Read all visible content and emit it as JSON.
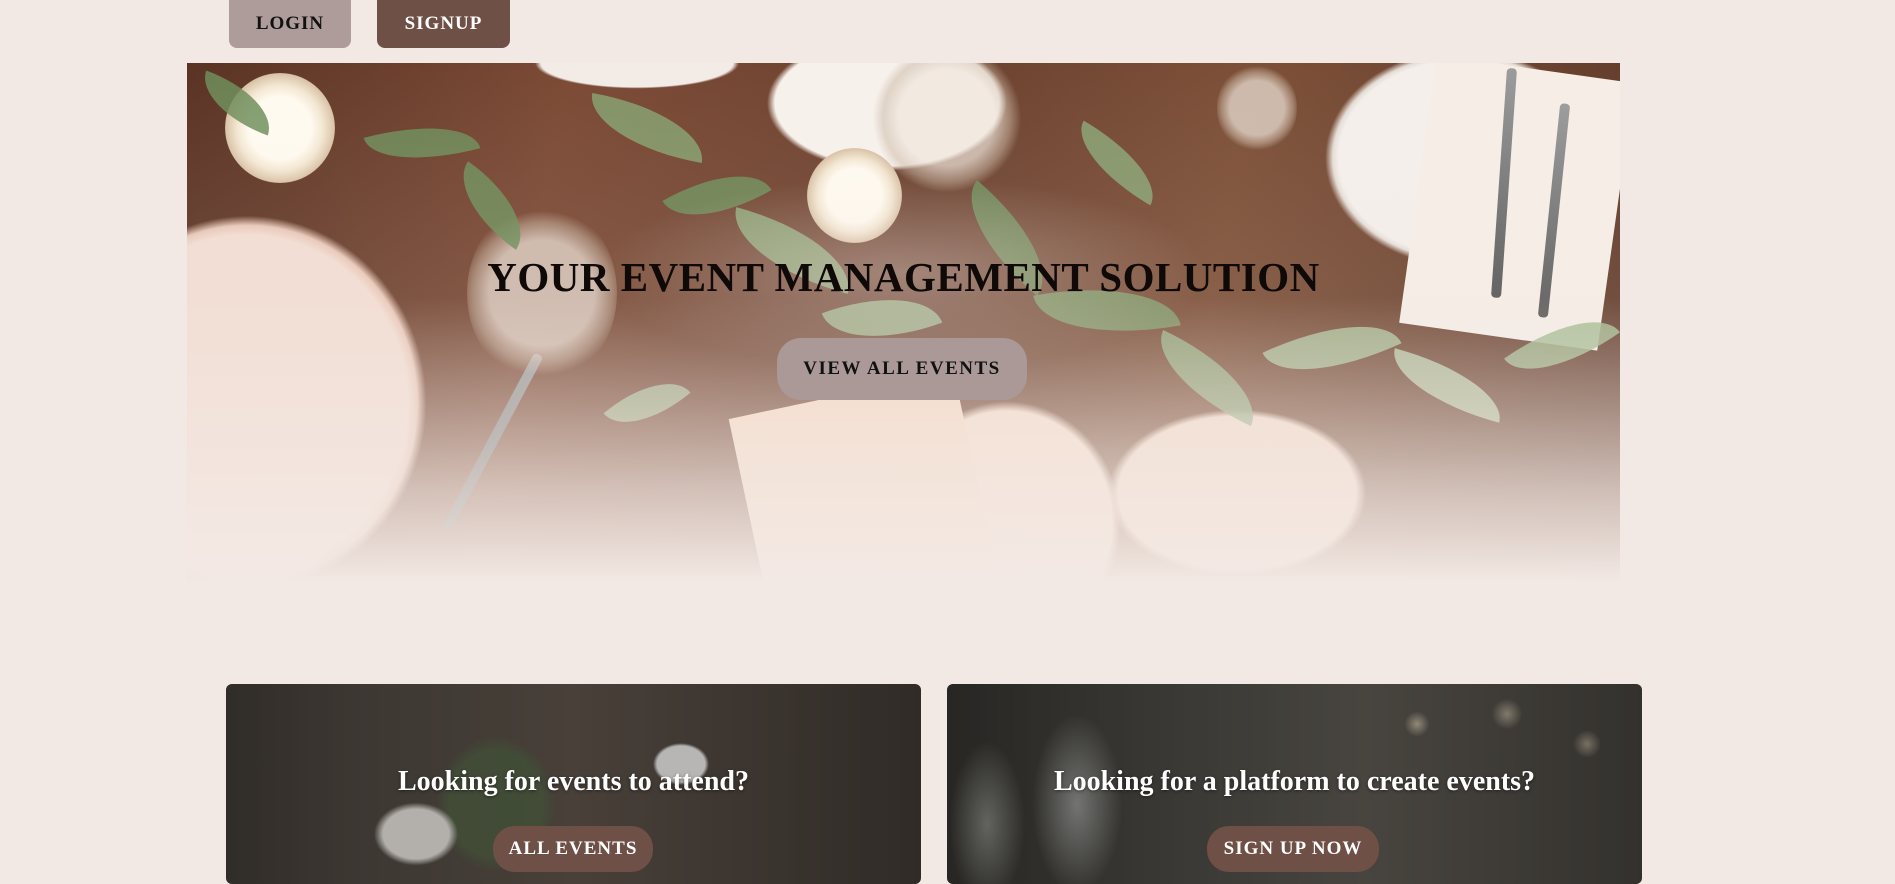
{
  "nav": {
    "login_label": "LOGIN",
    "signup_label": "SIGNUP"
  },
  "hero": {
    "title": "YOUR EVENT MANAGEMENT SOLUTION",
    "button_label": "VIEW ALL EVENTS"
  },
  "cards": [
    {
      "title": "Looking for events to attend?",
      "button_label": "ALL EVENTS"
    },
    {
      "title": "Looking for a platform to create events?",
      "button_label": "SIGN UP NOW"
    }
  ],
  "colors": {
    "background": "#f3e9e4",
    "login_button": "#ae9c9b",
    "signup_button": "#6f5046",
    "hero_button": "#ab9998"
  }
}
